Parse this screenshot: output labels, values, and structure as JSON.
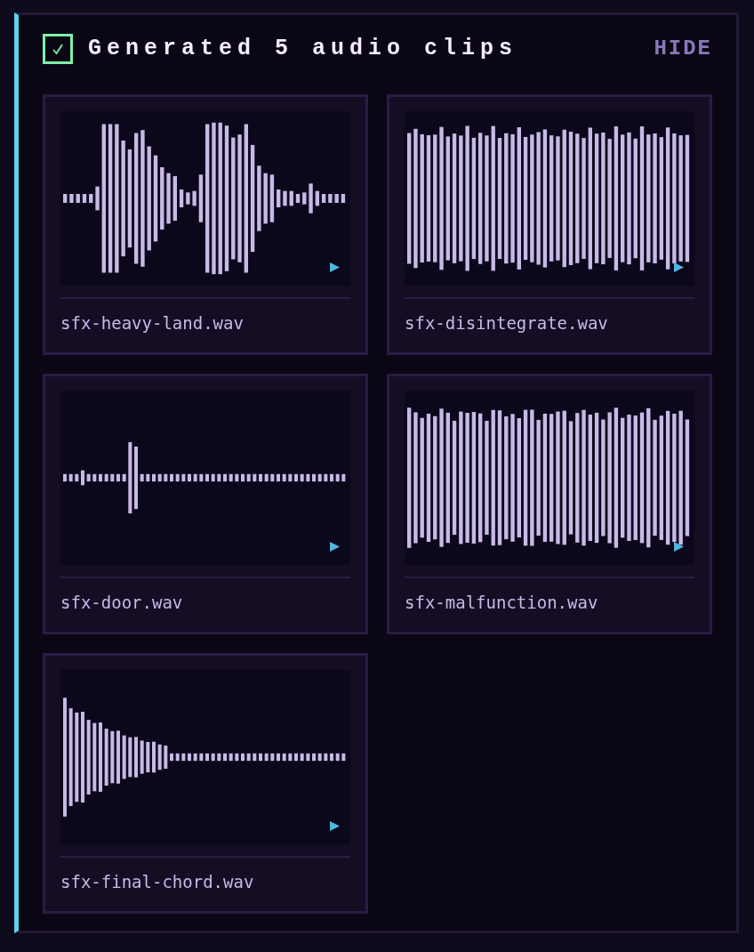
{
  "header": {
    "checked": true,
    "title": "Generated 5 audio clips",
    "action": "HIDE"
  },
  "clips": [
    {
      "filename": "sfx-heavy-land.wav"
    },
    {
      "filename": "sfx-disintegrate.wav"
    },
    {
      "filename": "sfx-door.wav"
    },
    {
      "filename": "sfx-malfunction.wav"
    },
    {
      "filename": "sfx-final-chord.wav"
    }
  ]
}
